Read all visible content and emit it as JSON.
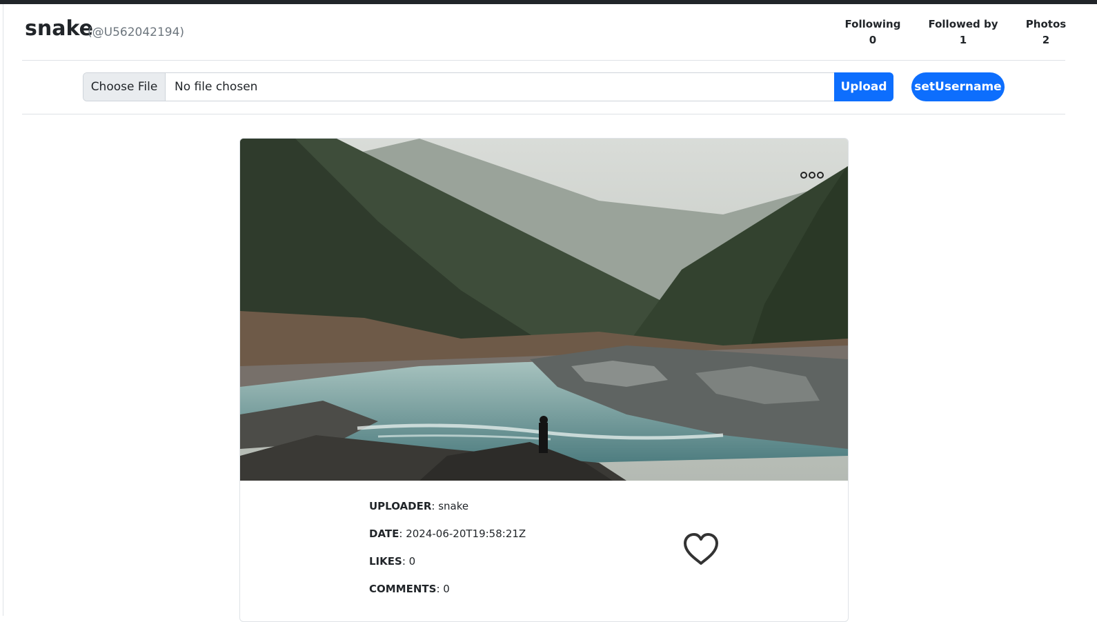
{
  "profile": {
    "name": "snake",
    "handle": "(@U562042194)"
  },
  "stats": [
    {
      "label": "Following",
      "value": "0"
    },
    {
      "label": "Followed by",
      "value": "1"
    },
    {
      "label": "Photos",
      "value": "2"
    }
  ],
  "upload_bar": {
    "choose_label": "Choose File",
    "file_status": "No file chosen",
    "upload_label": "Upload",
    "set_username_label": "setUsername"
  },
  "post": {
    "photo_icon": "misty-forest-river-photo",
    "more_icon": "more-options-icon",
    "like_icon": "heart-icon",
    "uploader_label": "UPLOADER",
    "uploader": "snake",
    "date_label": "DATE",
    "date": "2024-06-20T19:58:21Z",
    "likes_label": "LIKES",
    "likes": "0",
    "comments_label": "COMMENTS",
    "comments": "0"
  },
  "colors": {
    "primary": "#0d6efd",
    "topbar": "#212529",
    "muted": "#6c757d",
    "border": "#dee2e6"
  }
}
